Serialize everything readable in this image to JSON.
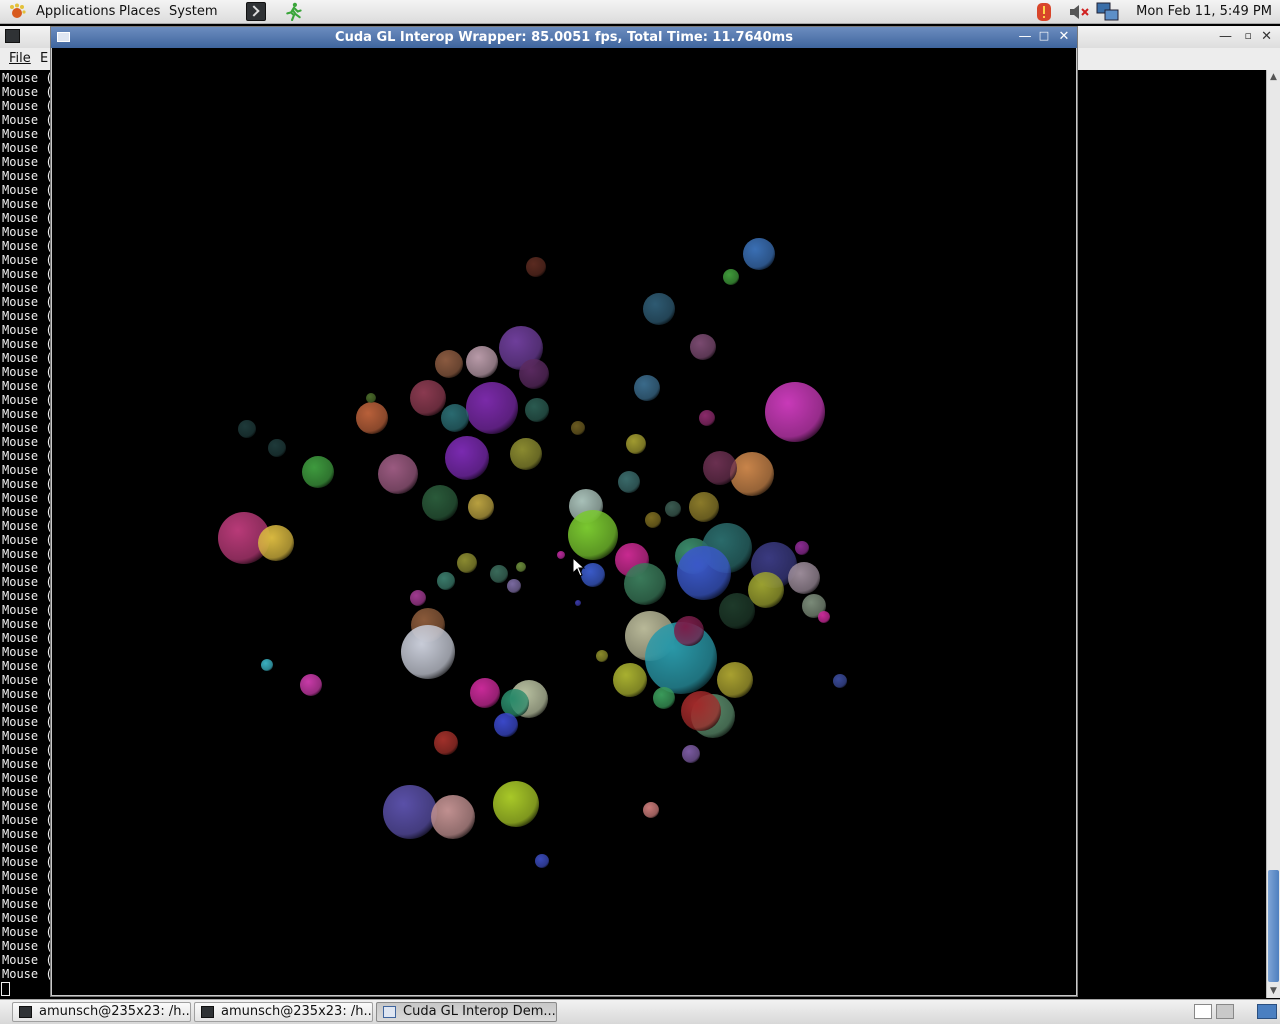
{
  "top_panel": {
    "menus": [
      "Applications",
      "Places",
      "System"
    ],
    "launchers": [
      "terminal-launcher",
      "running-man-launcher"
    ],
    "tray_icons": [
      "alert-icon",
      "volume-muted-icon",
      "network-icon"
    ],
    "clock": "Mon Feb 11,  5:49 PM"
  },
  "background_terminal": {
    "menu_visible": [
      "File",
      "E"
    ],
    "output_line": "Mouse (",
    "output_line_count": 65
  },
  "gl_window": {
    "title": "Cuda GL Interop Wrapper: 85.0051 fps, Total Time: 11.7640ms",
    "controls": [
      "minimize",
      "maximize",
      "close"
    ]
  },
  "taskbar": {
    "tasks": [
      {
        "label": "amunsch@235x23: /h...",
        "active": false,
        "icon": "terminal-icon"
      },
      {
        "label": "amunsch@235x23: /h...",
        "active": false,
        "icon": "terminal-icon"
      },
      {
        "label": "Cuda GL Interop Dem...",
        "active": true,
        "icon": "window-icon"
      }
    ]
  },
  "colors": {
    "title_active": "#4a6fa8",
    "panel": "#e6e6e6",
    "terminal_bg": "#000000"
  }
}
